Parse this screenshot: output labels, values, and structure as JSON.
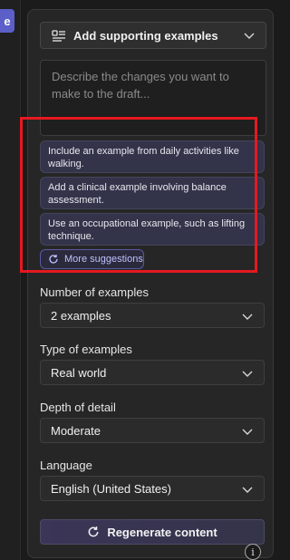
{
  "left_tab": {
    "label": "e"
  },
  "header_dropdown": {
    "label": "Add supporting examples",
    "icon": "list-icon"
  },
  "prompt": {
    "placeholder": "Describe the changes you want to make to the draft..."
  },
  "suggestions": [
    {
      "text": "Include an example from daily activities like walking."
    },
    {
      "text": "Add a clinical example involving balance assessment."
    },
    {
      "text": "Use an occupational example, such as lifting technique."
    }
  ],
  "more_suggestions": {
    "label": "More suggestions",
    "icon": "refresh-icon"
  },
  "number_of_examples": {
    "label": "Number of examples",
    "value": "2 examples"
  },
  "type_of_examples": {
    "label": "Type of examples",
    "value": "Real world"
  },
  "depth_of_detail": {
    "label": "Depth of detail",
    "value": "Moderate"
  },
  "language": {
    "label": "Language",
    "value": "English (United States)"
  },
  "regenerate": {
    "label": "Regenerate content",
    "icon": "refresh-icon"
  },
  "info": {
    "label": "i"
  },
  "colors": {
    "highlight": "#e5191f",
    "accent": "#5b5fc7",
    "background": "#1b1b1b"
  }
}
